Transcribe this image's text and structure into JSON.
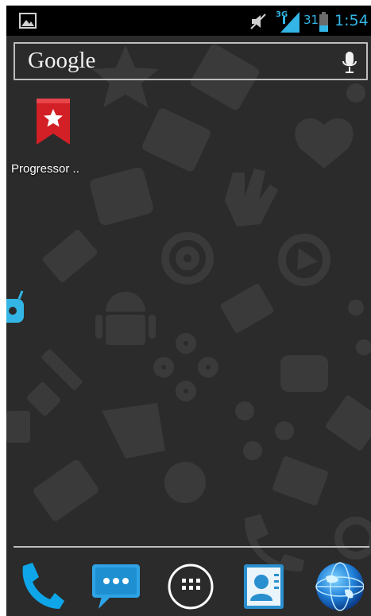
{
  "status_bar": {
    "notification_icon": "image-icon",
    "mute_icon": "muted-speaker-icon",
    "network_type": "3G",
    "signal_icon": "signal-strength-icon",
    "battery_level": "31",
    "battery_icon": "battery-icon",
    "time": "1:54",
    "accent_color": "#33b5e5"
  },
  "search": {
    "brand_text": "Google",
    "mic_icon": "microphone-icon"
  },
  "desktop": {
    "shortcuts": [
      {
        "label": "Progressor ..",
        "icon": "red-bookmark-star-icon",
        "color": "#d31f26"
      }
    ]
  },
  "dock": {
    "items": [
      {
        "name": "phone",
        "icon": "phone-icon"
      },
      {
        "name": "messaging",
        "icon": "messaging-icon"
      },
      {
        "name": "app-drawer",
        "icon": "app-drawer-icon"
      },
      {
        "name": "contacts",
        "icon": "contacts-icon"
      },
      {
        "name": "browser",
        "icon": "globe-icon"
      }
    ]
  }
}
